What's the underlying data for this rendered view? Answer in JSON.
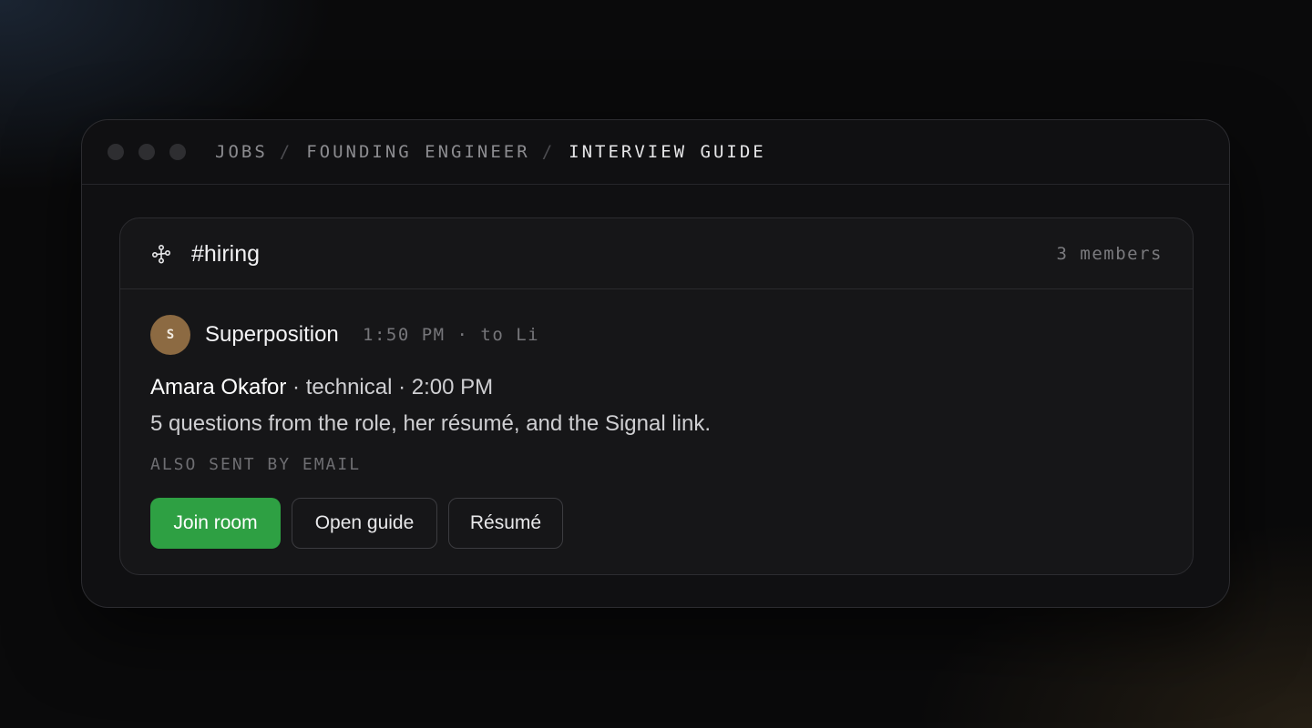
{
  "window": {
    "breadcrumb": [
      "JOBS",
      "FOUNDING ENGINEER",
      "INTERVIEW GUIDE"
    ],
    "separator": "/"
  },
  "channel": {
    "icon": "network-icon",
    "name": "#hiring",
    "members": "3 members"
  },
  "message": {
    "avatar_initial": "S",
    "sender": "Superposition",
    "meta": "1:50 PM · to Li",
    "candidate_name": "Amara Okafor",
    "candidate_details": " · technical · 2:00 PM",
    "body": "5 questions from the role, her résumé, and the Signal link.",
    "note": "ALSO SENT BY EMAIL"
  },
  "actions": {
    "join_label": "Join room",
    "guide_label": "Open guide",
    "resume_label": "Résumé"
  },
  "colors": {
    "primary_button": "#2ea043",
    "avatar": "#8c6a42"
  }
}
